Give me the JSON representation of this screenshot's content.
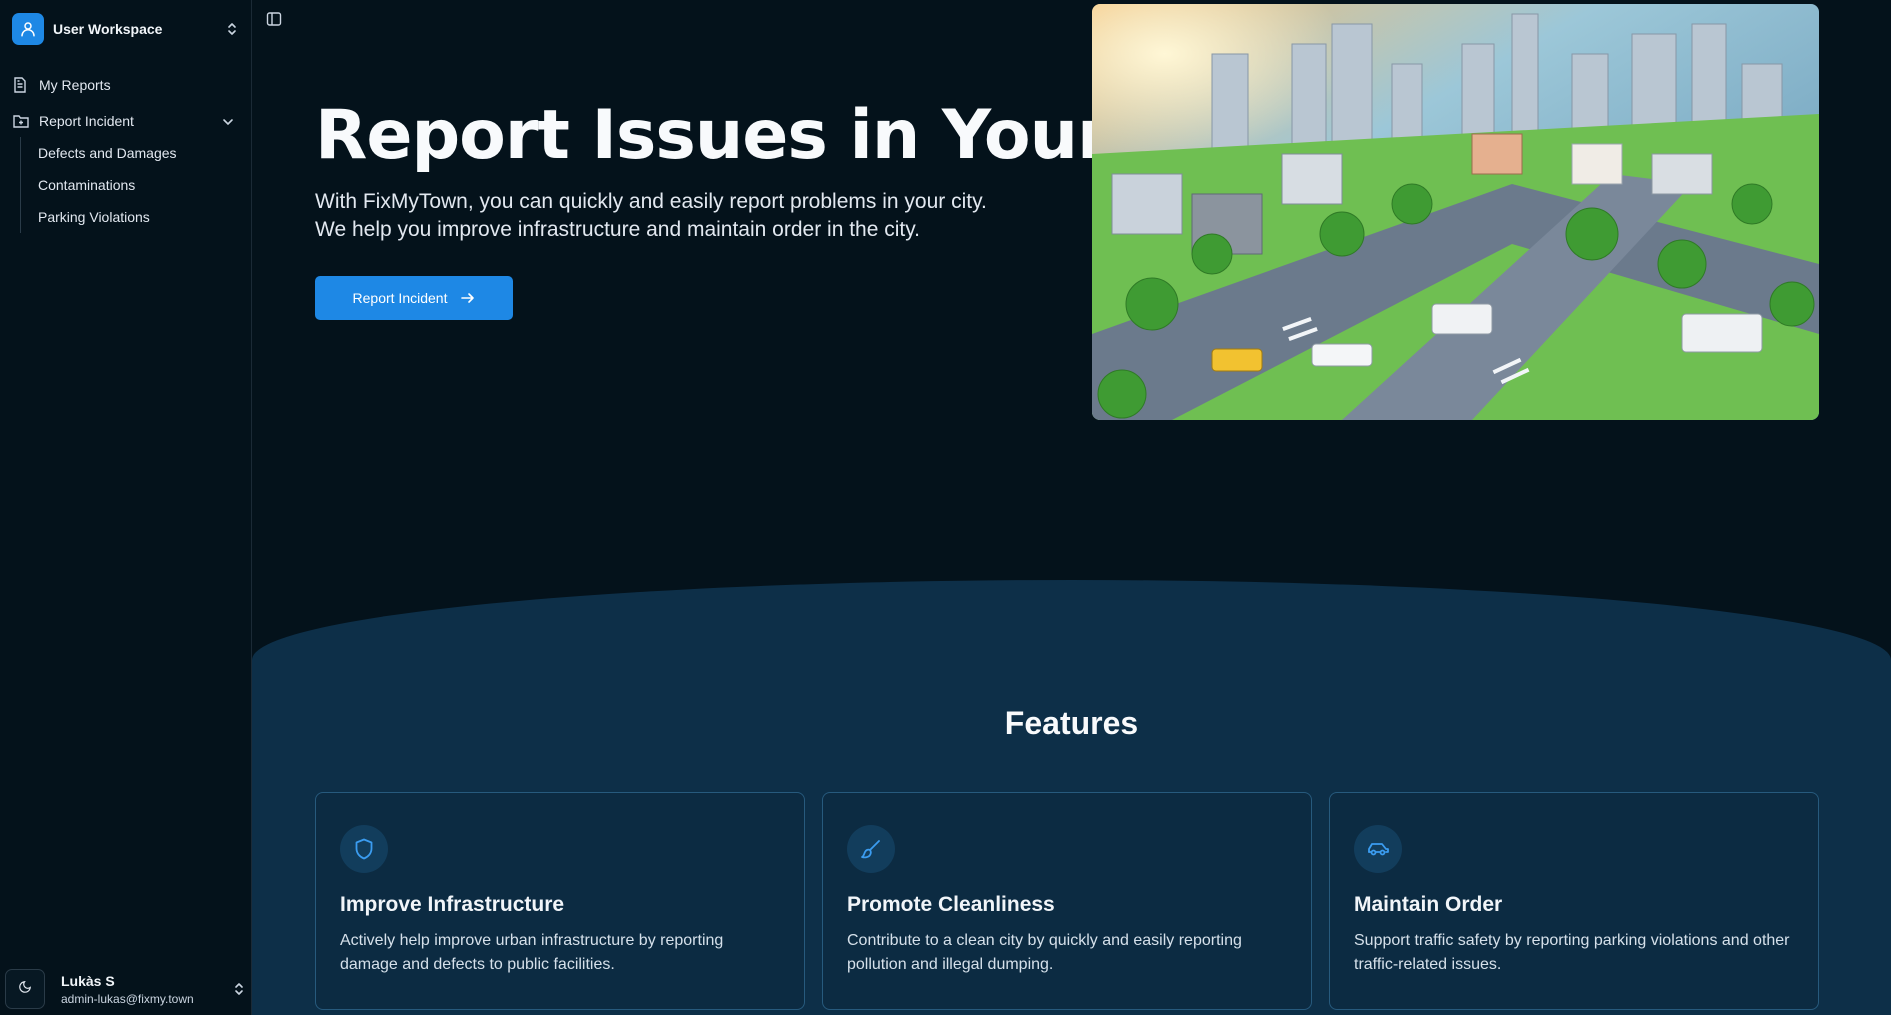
{
  "sidebar": {
    "workspace_name": "User Workspace",
    "nav": {
      "my_reports": "My Reports",
      "report_incident": "Report Incident",
      "sub_items": [
        "Defects and Damages",
        "Contaminations",
        "Parking Violations"
      ]
    },
    "user": {
      "name": "Lukàs S",
      "email": "admin-lukas@fixmy.town"
    }
  },
  "hero": {
    "title": "Report Issues in Your City",
    "subtitle_line1": "With FixMyTown, you can quickly and easily report problems in your city.",
    "subtitle_line2": "We help you improve infrastructure and maintain order in the city.",
    "cta_label": "Report Incident"
  },
  "features": {
    "title": "Features",
    "cards": [
      {
        "icon": "shield-icon",
        "title": "Improve Infrastructure",
        "text": "Actively help improve urban infrastructure by reporting damage and defects to public facilities."
      },
      {
        "icon": "brush-icon",
        "title": "Promote Cleanliness",
        "text": "Contribute to a clean city by quickly and easily reporting pollution and illegal dumping."
      },
      {
        "icon": "car-icon",
        "title": "Maintain Order",
        "text": "Support traffic safety by reporting parking violations and other traffic-related issues."
      }
    ]
  },
  "colors": {
    "accent": "#1e88e5",
    "background": "#04121b",
    "features_band": "#0d2f48"
  }
}
